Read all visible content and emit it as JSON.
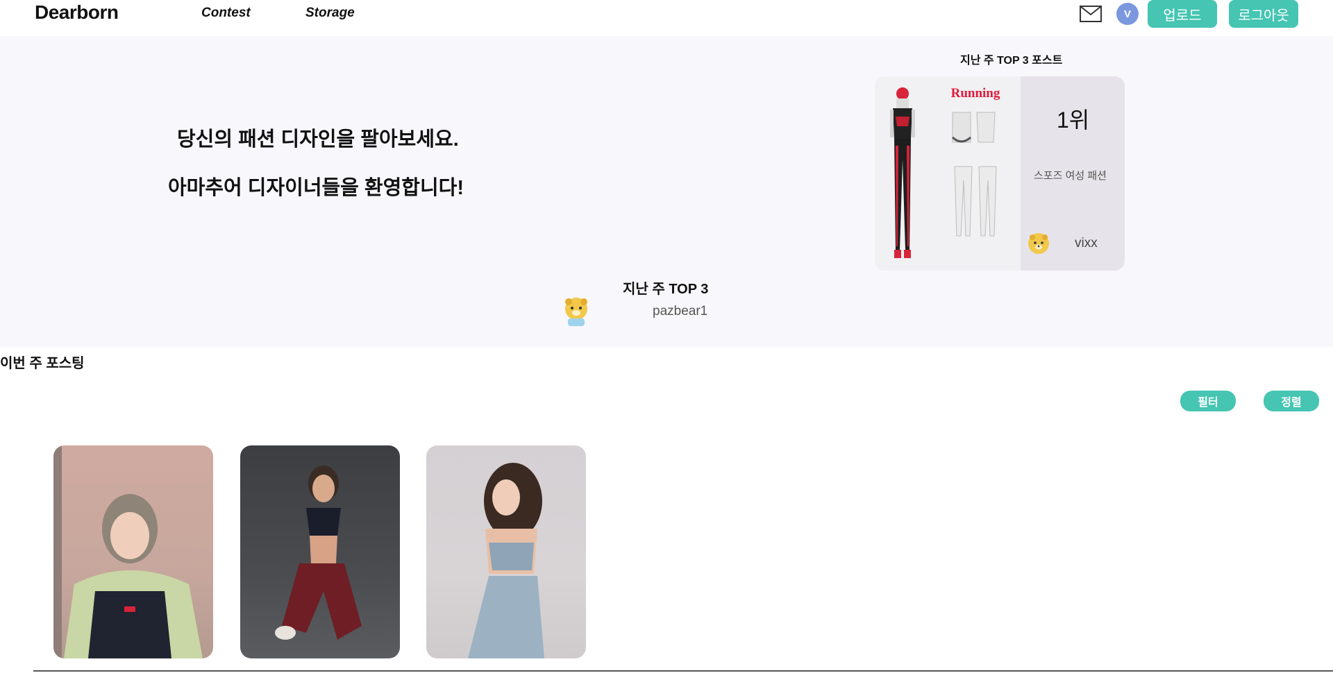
{
  "header": {
    "logo": "Dearborn",
    "nav": {
      "contest": "Contest",
      "storage": "Storage"
    },
    "user_initial": "V",
    "upload_label": "업로드",
    "logout_label": "로그아웃"
  },
  "hero": {
    "line1": "당신의 패션 디자인을 팔아보세요.",
    "line2": "아마추어 디자이너들을 환영합니다!"
  },
  "top_post": {
    "section_title": "지난 주 TOP 3 포스트",
    "image_caption": "Running",
    "rank": "1위",
    "title": "스포즈 여성 패션",
    "user": "vixx"
  },
  "top_week": {
    "title": "지난 주 TOP 3",
    "user": "pazbear1"
  },
  "posting": {
    "title": "이번 주 포스팅",
    "filter_label": "필터",
    "sort_label": "정렬"
  },
  "colors": {
    "accent": "#45c5b2",
    "hero_bg": "#f8f7fb",
    "card_bg": "#e6e4ea",
    "avatar": "#7b97de"
  },
  "icons": {
    "mail": "mail-icon",
    "bear": "bear-avatar-icon"
  }
}
